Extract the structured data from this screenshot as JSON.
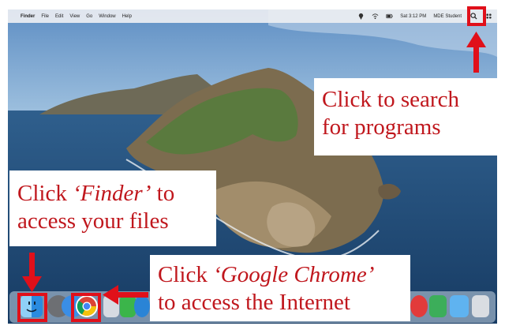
{
  "menubar": {
    "apple_glyph": "",
    "app_name": "Finder",
    "menus": [
      "File",
      "Edit",
      "View",
      "Go",
      "Window",
      "Help"
    ],
    "clock": "Sat 3:12 PM",
    "user": "MDE Student"
  },
  "callouts": {
    "search": {
      "line1": "Click to search",
      "line2": "for programs"
    },
    "finder": {
      "pre": "Click ",
      "emph": "‘Finder’",
      "post": " to",
      "line2": "access your files"
    },
    "chrome": {
      "pre": "Click ",
      "emph": "‘Google Chrome’",
      "line2": "to access the Internet"
    }
  },
  "dock": {
    "items": [
      "finder-icon",
      "launchpad-icon",
      "safari-icon",
      "chrome-icon",
      "mail-icon",
      "messages-icon",
      "facetime-icon",
      "maps-icon",
      "folder-icon",
      "trash-icon"
    ]
  },
  "colors": {
    "annotation_red": "#e0101a",
    "callout_text": "#c0171d",
    "menubar_bg": "#ebeef2"
  }
}
